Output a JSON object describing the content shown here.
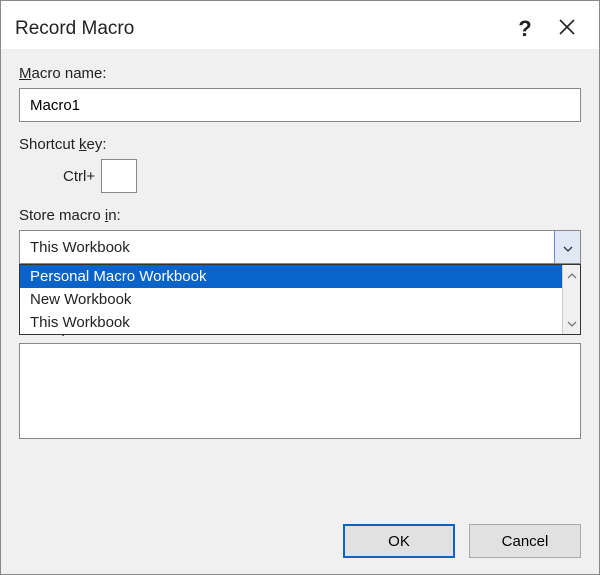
{
  "dialog": {
    "title": "Record Macro",
    "help_symbol": "?"
  },
  "macro_name": {
    "label_pre": "M",
    "label_post": "acro name:",
    "value": "Macro1"
  },
  "shortcut": {
    "label_pre": "Shortcut ",
    "label_mid": "k",
    "label_post": "ey:",
    "prefix": "Ctrl+",
    "value": ""
  },
  "store": {
    "label_pre": "Store macro ",
    "label_mid": "i",
    "label_post": "n:",
    "selected": "This Workbook",
    "options": [
      "Personal Macro Workbook",
      "New Workbook",
      "This Workbook"
    ]
  },
  "description": {
    "label_pre": "D",
    "label_mid": "e",
    "label_post": "scription:",
    "value": ""
  },
  "buttons": {
    "ok": "OK",
    "cancel": "Cancel"
  }
}
